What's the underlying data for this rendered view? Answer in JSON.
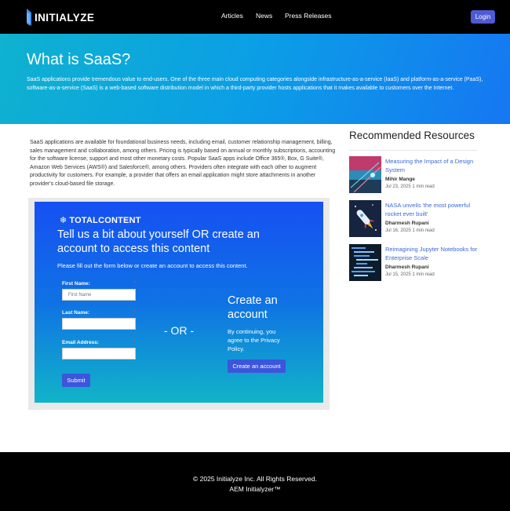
{
  "header": {
    "logo_text": "INITIALYZE",
    "nav": [
      "Articles",
      "News",
      "Press Releases"
    ],
    "login_label": "Login"
  },
  "hero": {
    "title": "What is SaaS?",
    "description": "SaaS applications provide tremendous value to end-users. One of the three main cloud computing categories alongside infrastructure-as-a-service (IaaS) and platform-as-a-service (PaaS), software-as-a-service (SaaS) is a web-based software distribution model in which a third-party provider hosts applications that it makes available to customers over the Internet."
  },
  "article": {
    "body": "SaaS applications are available for foundational business needs, including email, customer relationship management, billing, sales management and collaboration, among others. Pricing is typically based on annual or monthly subscriptions, accounting for the software license, support and most other monetary costs. Popular SaaS apps include Office 365®, Box, G Suite®, Amazon Web Services (AWS®) and Salesforce®, among others. Providers often integrate with each other to augment productivity for customers. For example, a provider that offers an email application might store attachments in another provider's cloud-based file storage."
  },
  "form": {
    "brand": "TOTALCONTENT",
    "title": "Tell us a bit about yourself OR create an account to access this content",
    "subtitle": "Please fill out the form below or create an account to access this content.",
    "first_name_label": "First Name:",
    "first_name_placeholder": "First Name",
    "last_name_label": "Last Name:",
    "email_label": "Email Address:",
    "required_mark": "*",
    "submit_label": "Submit",
    "or_text": "- OR -",
    "create_title": "Create an account",
    "create_desc": "By continuing, you agree to the Privacy Policy.",
    "create_button": "Create an account"
  },
  "sidebar": {
    "title": "Recommended Resources",
    "items": [
      {
        "title": "Measuring the Impact of a Design System",
        "author": "Mihir Mange",
        "meta": "Jul 23, 2025 1 min read"
      },
      {
        "title": "NASA unveils 'the most powerful rocket ever built'",
        "author": "Dharmesh Rupani",
        "meta": "Jul 16, 2025 1 min read"
      },
      {
        "title": "Reimagining Jupyter Notebooks for Enterprise Scale",
        "author": "Dharmesh Rupani",
        "meta": "Jul 15, 2025 1 min read"
      }
    ]
  },
  "footer": {
    "copyright": "© 2025 Initialyze Inc. All Rights Reserved.",
    "tagline": "AEM Initialyzer™"
  },
  "colors": {
    "accent": "#4f5bd5",
    "link": "#3a68d8",
    "hero_start": "#0fb2cf",
    "hero_end": "#1677f2"
  }
}
